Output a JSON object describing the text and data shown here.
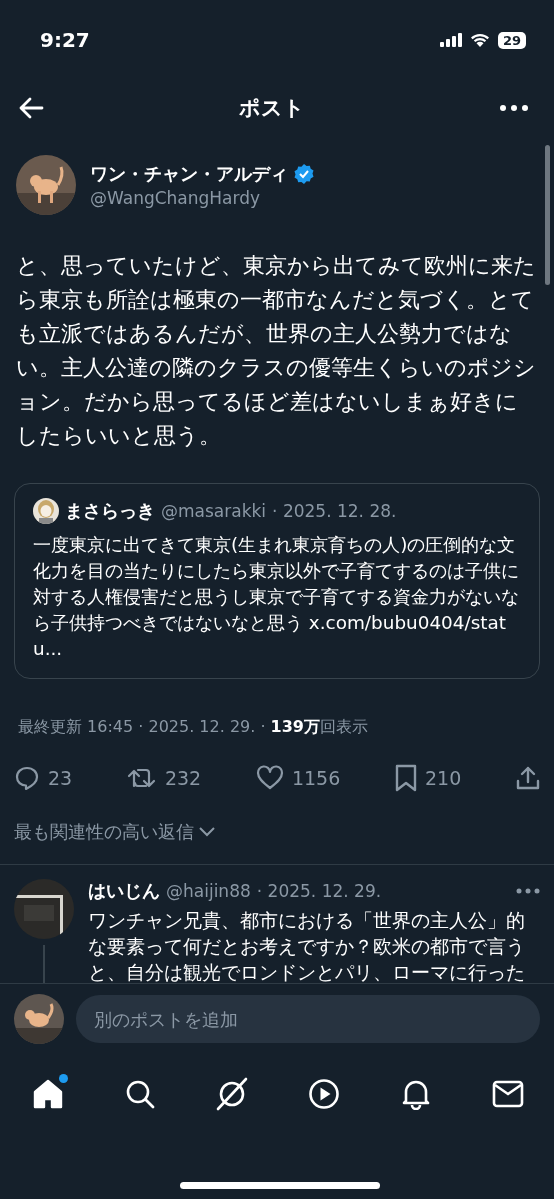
{
  "status_bar": {
    "time": "9:27",
    "battery": "29"
  },
  "header": {
    "title": "ポスト"
  },
  "post": {
    "author": {
      "name": "ワン・チャン・アルディ",
      "handle": "@WangChangHardy",
      "verified": true
    },
    "text": "と、思っていたけど、東京から出てみて欧州に来たら東京も所詮は極東の一都市なんだと気づく。とても立派ではあるんだが、世界の主人公勢力ではない。主人公達の隣のクラスの優等生くらいのポジション。だから思ってるほど差はないしまぁ好きにしたらいいと思う。",
    "quote": {
      "name": "まさらっき",
      "handle": "@masarakki",
      "date": "· 2025. 12. 28.",
      "text": "一度東京に出てきて東京(生まれ東京育ちの人)の圧倒的な文化力を目の当たりにしたら東京以外で子育てするのは子供に対する人権侵害だと思うし東京で子育てする資金力がないなら子供持つべきではないなと思う x.com/bubu0404/statu..."
    },
    "meta": "最終更新 16:45 · 2025. 12. 29.  · **139万**回表示",
    "actions": [
      {
        "kind": "reply",
        "count": "23"
      },
      {
        "kind": "repost",
        "count": "232"
      },
      {
        "kind": "like",
        "count": "1156"
      },
      {
        "kind": "bookmark",
        "count": "210"
      },
      {
        "kind": "share"
      }
    ]
  },
  "replies_sort": "最も関連性の高い返信",
  "replies": [
    {
      "name": "はいじん",
      "handle": "@haijin88",
      "date": "· 2025. 12. 29.",
      "text": "ワンチャン兄貴、都市における「世界の主人公」的な要素って何だとお考えですか？欧米の都市で言うと、自分は観光でロンドンとパリ、ローマに行った"
    }
  ],
  "composer": {
    "placeholder": "別のポストを追加"
  },
  "tabs": [
    {
      "kind": "home",
      "selected": true,
      "unread": true
    },
    {
      "kind": "search",
      "selected": false,
      "unread": false
    },
    {
      "kind": "grok",
      "selected": false,
      "unread": false
    },
    {
      "kind": "video",
      "selected": false,
      "unread": false
    },
    {
      "kind": "notifications",
      "selected": false,
      "unread": false
    },
    {
      "kind": "messages",
      "selected": false,
      "unread": false
    }
  ]
}
